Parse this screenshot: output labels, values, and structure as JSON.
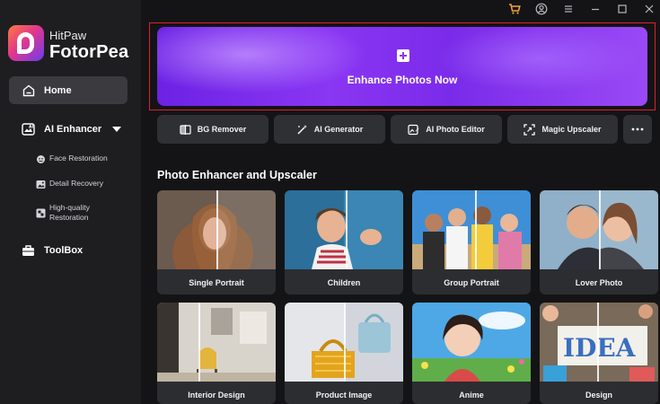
{
  "brand": {
    "top": "HitPaw",
    "main": "FotorPea"
  },
  "sidebar": {
    "home": "Home",
    "ai_enhancer": "AI Enhancer",
    "sub_items": [
      {
        "label": "Face Restoration"
      },
      {
        "label": "Detail Recovery"
      },
      {
        "label": "High-quality\nRestoration"
      }
    ],
    "toolbox": "ToolBox"
  },
  "hero": {
    "label": "Enhance Photos Now"
  },
  "tools": [
    {
      "label": "BG Remover",
      "icon": "bg-remover-icon"
    },
    {
      "label": "AI Generator",
      "icon": "wand-icon"
    },
    {
      "label": "AI Photo Editor",
      "icon": "photo-edit-icon"
    },
    {
      "label": "Magic Upscaler",
      "icon": "upscale-icon"
    }
  ],
  "section": {
    "title": "Photo Enhancer and Upscaler"
  },
  "cards": [
    {
      "label": "Single Portrait"
    },
    {
      "label": "Children"
    },
    {
      "label": "Group Portrait"
    },
    {
      "label": "Lover Photo"
    },
    {
      "label": "Interior Design"
    },
    {
      "label": "Product Image"
    },
    {
      "label": "Anime"
    },
    {
      "label": "Design"
    }
  ],
  "colors": {
    "accent": "#8a36f3",
    "highlight_frame": "#e01e2e",
    "sidebar_bg": "#1e1e21",
    "content_bg": "#141416"
  }
}
